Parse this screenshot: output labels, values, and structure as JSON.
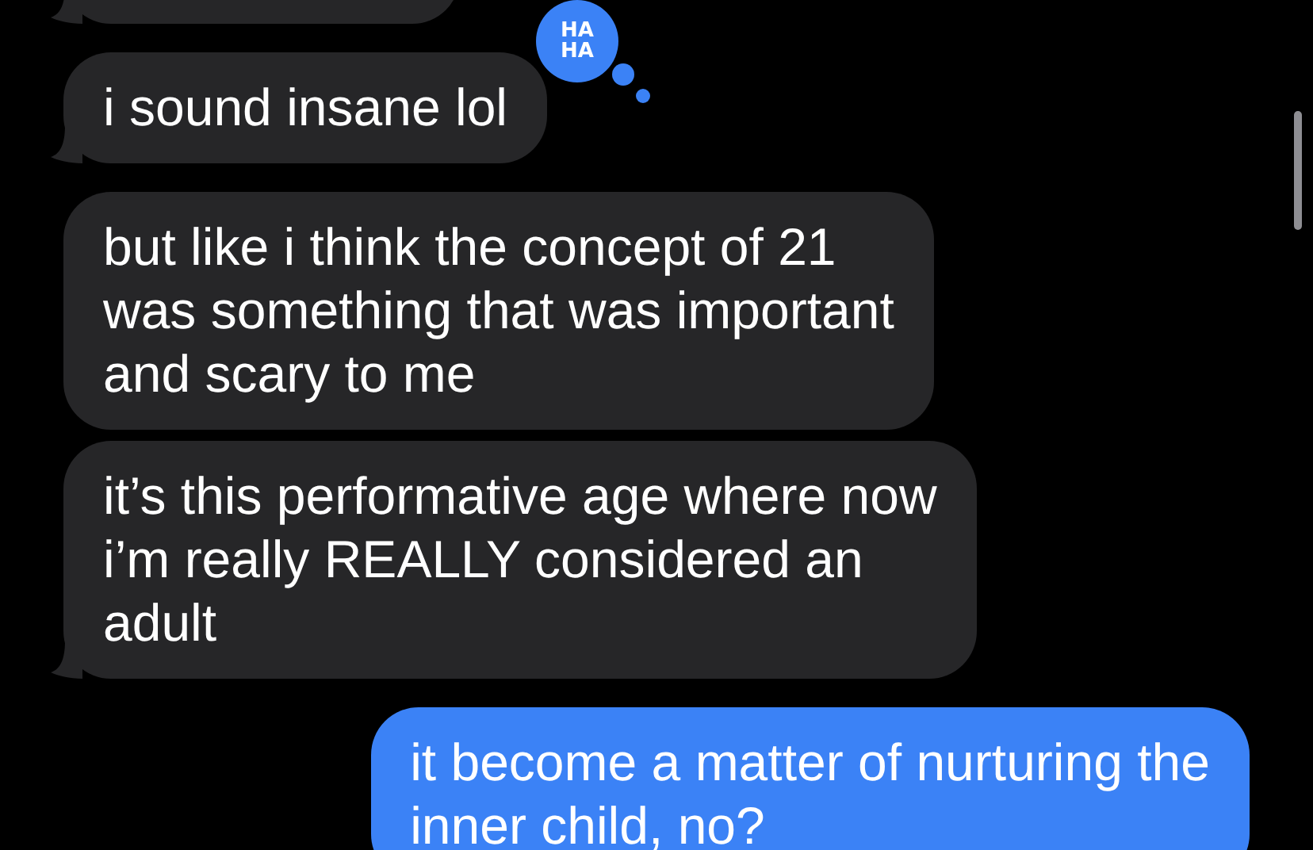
{
  "messages": [
    {
      "kind": "received",
      "tail": true
    },
    {
      "kind": "received",
      "tail": true,
      "text": "i sound insane lol",
      "tapback": "HA\nHA"
    },
    {
      "kind": "received",
      "tail": false,
      "text": "but like i think the concept of 21\nwas something that was important\nand scary to me"
    },
    {
      "kind": "received",
      "tail": true,
      "text": "it’s this performative age where now\ni’m really REALLY considered an\nadult"
    },
    {
      "kind": "sent",
      "tail": false,
      "text": "it become a matter of nurturing the\ninner child, no?"
    }
  ]
}
